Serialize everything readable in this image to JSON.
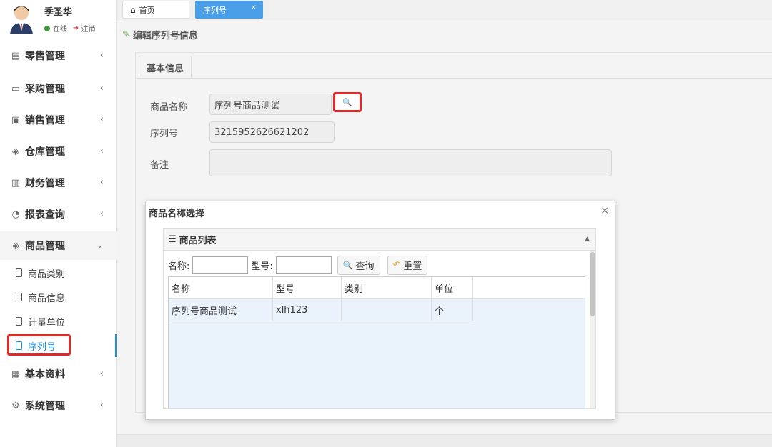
{
  "user": {
    "name": "季圣华",
    "status": "在线",
    "logout": "注销"
  },
  "sidebar": {
    "items": [
      {
        "label": "零售管理",
        "icon": "gift-icon"
      },
      {
        "label": "采购管理",
        "icon": "monitor-icon"
      },
      {
        "label": "销售管理",
        "icon": "briefcase-icon"
      },
      {
        "label": "仓库管理",
        "icon": "layers-icon"
      },
      {
        "label": "财务管理",
        "icon": "book-icon"
      },
      {
        "label": "报表查询",
        "icon": "clock-icon"
      },
      {
        "label": "商品管理",
        "icon": "package-icon"
      },
      {
        "label": "基本资料",
        "icon": "grid-icon"
      },
      {
        "label": "系统管理",
        "icon": "settings-icon"
      }
    ],
    "sub_items": [
      {
        "label": "商品类别"
      },
      {
        "label": "商品信息"
      },
      {
        "label": "计量单位"
      },
      {
        "label": "序列号"
      }
    ]
  },
  "tabs": {
    "home": "首页",
    "active": "序列号",
    "close": "×"
  },
  "page": {
    "title": "编辑序列号信息",
    "section_tab": "基本信息"
  },
  "form": {
    "product_label": "商品名称",
    "product_value": "序列号商品测试",
    "serial_label": "序列号",
    "serial_value": "3215952626621202",
    "remark_label": "备注",
    "remark_value": ""
  },
  "dialog": {
    "title": "商品名称选择",
    "close": "×",
    "list_title": "商品列表",
    "filter_name_label": "名称:",
    "filter_model_label": "型号:",
    "search_button": "查询",
    "reset_button": "重置",
    "columns": [
      "名称",
      "型号",
      "类别",
      "单位"
    ],
    "rows": [
      {
        "name": "序列号商品测试",
        "model": "xlh123",
        "category": "",
        "unit": "个"
      }
    ]
  },
  "colors": {
    "accent": "#4a9ee8",
    "highlight": "#e02a2a",
    "active_link": "#1a8fe0"
  }
}
